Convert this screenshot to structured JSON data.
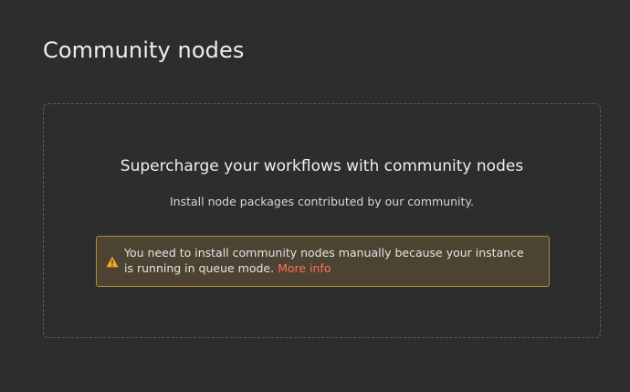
{
  "page": {
    "title": "Community nodes"
  },
  "empty_state": {
    "heading": "Supercharge your workflows with community nodes",
    "description": "Install node packages contributed by our community."
  },
  "warning": {
    "icon": "warning-triangle-icon",
    "message": "You need to install community nodes manually because your instance is running in queue mode.",
    "link_label": "More info"
  },
  "colors": {
    "background": "#2c2d2c",
    "warning_background": "#4d4332",
    "warning_border": "#b48a3c",
    "warning_icon": "#f5a623",
    "link": "#ff6f5c"
  }
}
